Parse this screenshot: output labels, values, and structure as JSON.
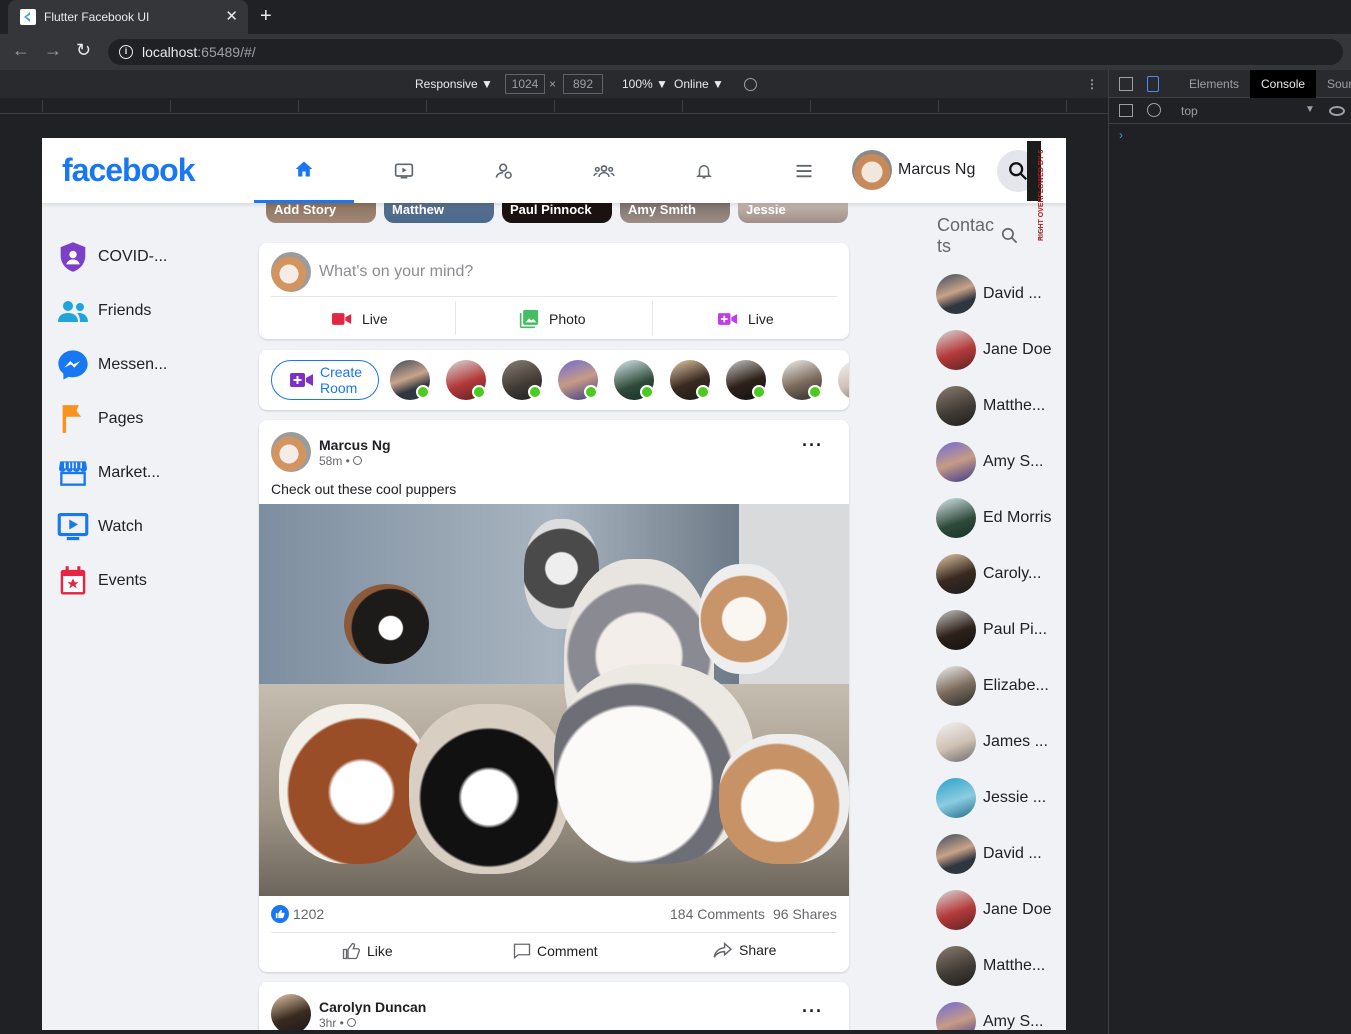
{
  "browser": {
    "tab_title": "Flutter Facebook UI",
    "url_host": "localhost",
    "url_rest": ":65489/#/"
  },
  "device_toolbar": {
    "mode": "Responsive ▼",
    "width": "1024",
    "times": "×",
    "height": "892",
    "zoom": "100% ▼",
    "throttle": "Online ▼"
  },
  "devtools": {
    "tabs": [
      "Elements",
      "Console",
      "Sour"
    ],
    "context": "top"
  },
  "app": {
    "logo": "facebook",
    "user_name": "Marcus Ng",
    "overflow_label": "RIGHT OVERFLOWED BY 6",
    "left_nav": [
      "COVID-...",
      "Friends",
      "Messen...",
      "Pages",
      "Market...",
      "Watch",
      "Events"
    ],
    "stories": [
      "Add Story",
      "Matthew",
      "Paul Pinnock",
      "Amy Smith",
      "Jessie"
    ],
    "create_post": {
      "placeholder": "What's on your mind?",
      "live": "Live",
      "photo": "Photo",
      "room": "Live"
    },
    "rooms": {
      "create_line1": "Create",
      "create_line2": "Room"
    },
    "post1": {
      "author": "Marcus Ng",
      "time": "58m • ",
      "caption": "Check out these cool puppers",
      "likes": "1202",
      "comments": "184 Comments",
      "shares": "96 Shares",
      "like_btn": "Like",
      "comment_btn": "Comment",
      "share_btn": "Share"
    },
    "post2": {
      "author": "Carolyn Duncan",
      "time": "3hr • "
    },
    "contacts_title": "Contacts",
    "contacts": [
      "David ...",
      "Jane Doe",
      "Matthe...",
      "Amy S...",
      "Ed Morris",
      "Caroly...",
      "Paul Pi...",
      "Elizabe...",
      "James ...",
      "Jessie ...",
      "David ...",
      "Jane Doe",
      "Matthe...",
      "Amy S..."
    ]
  },
  "colors": {
    "facebook_blue": "#1877f2",
    "online_green": "#4bcb1f",
    "live_red": "#e42645",
    "photo_green": "#45bd62",
    "room_purple": "#c03ee7"
  }
}
